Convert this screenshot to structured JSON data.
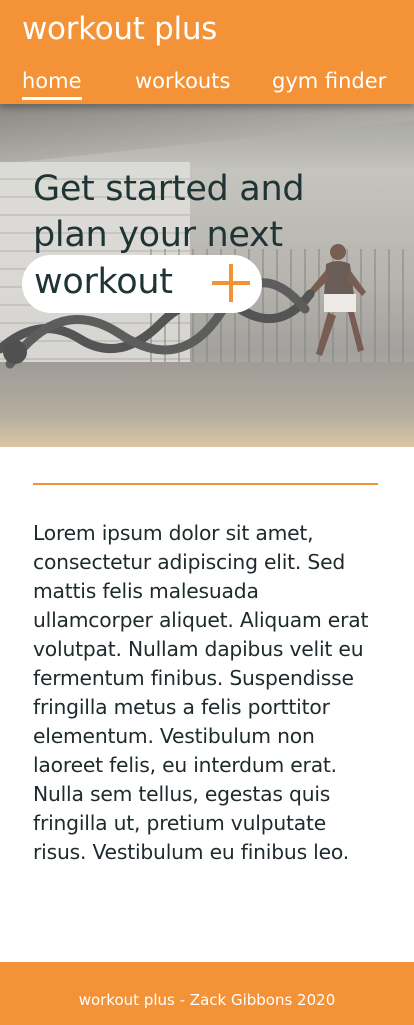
{
  "header": {
    "brand": "workout plus",
    "nav": [
      "home",
      "workouts",
      "gym finder"
    ]
  },
  "hero": {
    "title": "Get started and plan your next",
    "pill_text": "workout"
  },
  "body": {
    "paragraph": "Lorem ipsum dolor sit amet, consectetur adipiscing elit. Sed mattis felis malesuada ullamcorper aliquet. Aliquam erat volutpat. Nullam dapibus velit eu fermentum finibus. Suspendisse fringilla metus a felis porttitor elementum. Vestibulum non laoreet felis, eu interdum erat. Nulla sem tellus, egestas quis fringilla ut, pretium vulputate risus. Vestibulum eu finibus leo."
  },
  "footer": {
    "text": "workout plus - Zack Gibbons 2020"
  },
  "colors": {
    "accent": "#f39237",
    "text": "#1e2a2b",
    "heading": "#1f3434"
  },
  "icons": {
    "add": "plus-icon"
  }
}
